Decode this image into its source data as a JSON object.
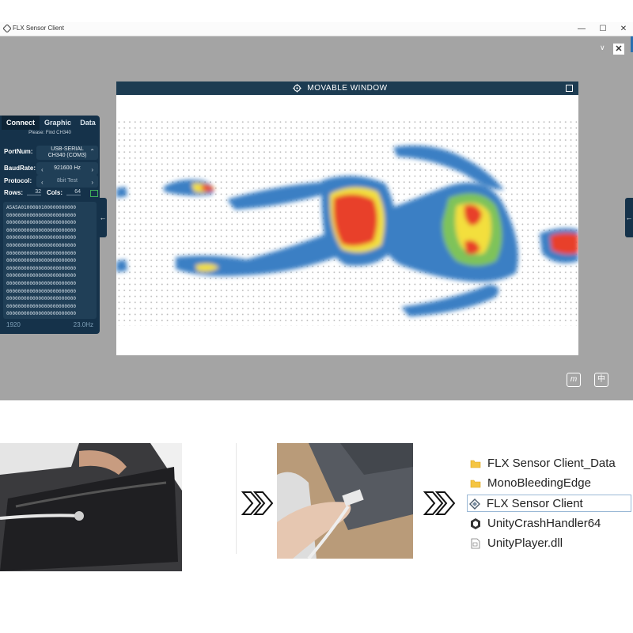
{
  "window": {
    "title": "FLX Sensor Client",
    "minimize": "—",
    "maximize": "☐",
    "close": "✕"
  },
  "toolbar": {
    "chevron": "∨",
    "close": "✕"
  },
  "movable_window": {
    "title": "MOVABLE WINDOW"
  },
  "panel": {
    "tabs": [
      "Connect",
      "Graphic",
      "Data"
    ],
    "hint": "Please: Find CH340",
    "port_label": "PortNum:",
    "port_value_line1": "USB-SERIAL",
    "port_value_line2": "CH340 (COM3)",
    "baud_label": "BaudRate:",
    "baud_value": "921600 Hz",
    "protocol_label": "Protocol:",
    "protocol_value": "8bit Test",
    "rows_label": "Rows:",
    "rows_value": "32",
    "cols_label": "Cols:",
    "cols_value": "64",
    "data_lines": [
      "A5A5A0100080100000000000",
      "000000000000000000000000",
      "000000000000000000000000",
      "000000000000000000000000",
      "000000000000000000000000",
      "000000000000000000000000",
      "000000000000000000000000",
      "000000000000000000000000",
      "000000000000000000000000",
      "000000000000000000000000",
      "000000000000000000000000",
      "000000000000000000000000",
      "000000000000000000000000",
      "000000000000000000000000",
      "000000000000000000000000"
    ],
    "footer_left": "1920",
    "footer_right": "23.0Hz"
  },
  "side_tabs": {
    "left": "←",
    "right": "←"
  },
  "bottom_icons": {
    "left": "m",
    "right": "中"
  },
  "colors": {
    "panel": "#15324a",
    "heat_blue": "#3a7fc4",
    "heat_green": "#7ec35a",
    "heat_yellow": "#f3df3c",
    "heat_red": "#e8402c"
  },
  "files": [
    {
      "name": "FLX Sensor Client_Data",
      "icon": "folder-icon"
    },
    {
      "name": "MonoBleedingEdge",
      "icon": "folder-icon"
    },
    {
      "name": "FLX Sensor Client",
      "icon": "unity-app-icon"
    },
    {
      "name": "UnityCrashHandler64",
      "icon": "unity-crash-icon"
    },
    {
      "name": "UnityPlayer.dll",
      "icon": "dll-file-icon"
    }
  ]
}
